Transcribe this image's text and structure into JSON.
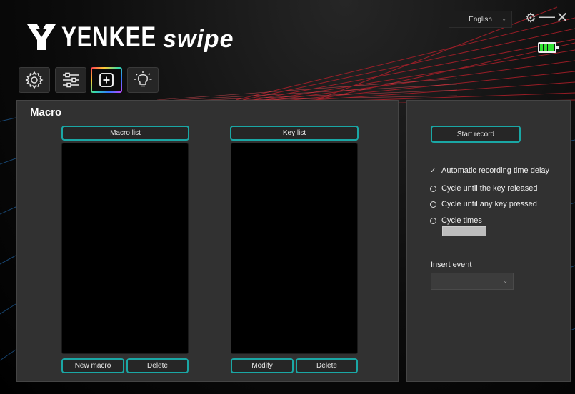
{
  "app": {
    "brand": "YENKEE",
    "product": "swipe"
  },
  "header": {
    "language": "English",
    "battery_level": 1.0
  },
  "nav": {
    "items": [
      {
        "name": "settings",
        "icon": "gear-icon"
      },
      {
        "name": "adjust",
        "icon": "sliders-icon"
      },
      {
        "name": "macro",
        "icon": "plus-square-icon",
        "active": true
      },
      {
        "name": "lighting",
        "icon": "lightbulb-icon"
      }
    ]
  },
  "macro_panel": {
    "title": "Macro",
    "macro_list_header": "Macro list",
    "key_list_header": "Key list",
    "new_macro_label": "New macro",
    "delete_macro_label": "Delete",
    "modify_label": "Modify",
    "delete_key_label": "Delete"
  },
  "record_panel": {
    "start_record_label": "Start record",
    "auto_delay_label": "Automatic recording time delay",
    "auto_delay_checked": true,
    "cycle_release_label": "Cycle until the key released",
    "cycle_any_label": "Cycle until any key pressed",
    "cycle_times_label": "Cycle times",
    "cycle_times_value": "",
    "insert_event_label": "Insert event",
    "insert_event_value": ""
  },
  "colors": {
    "accent": "#1aa7a5",
    "battery": "#30e030",
    "stripe": "#d3303a"
  }
}
